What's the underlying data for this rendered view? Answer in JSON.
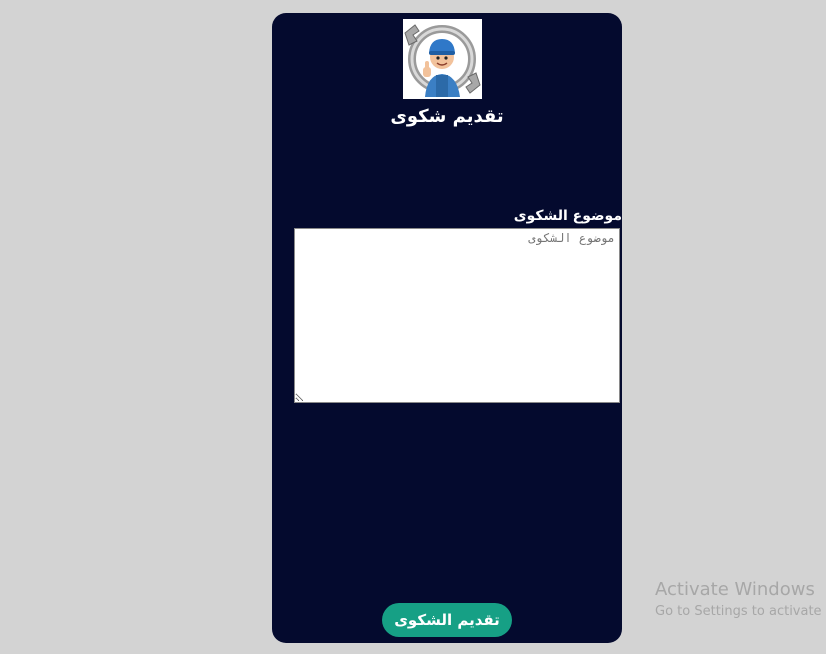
{
  "page": {
    "title": "تقديم شكوى",
    "logo_icon": "mechanic-with-wrench-icon"
  },
  "form": {
    "field_label": "موضوع الشكوى",
    "textarea_placeholder": "موضوع الشكوى",
    "textarea_value": "",
    "submit_label": "تقديم الشكوى"
  },
  "watermark": {
    "title": "Activate Windows",
    "subtitle": "Go to Settings to activate"
  },
  "colors": {
    "page_background": "#d3d3d3",
    "card_background": "#040a2e",
    "button_background": "#16a085",
    "text_light": "#ffffff"
  }
}
